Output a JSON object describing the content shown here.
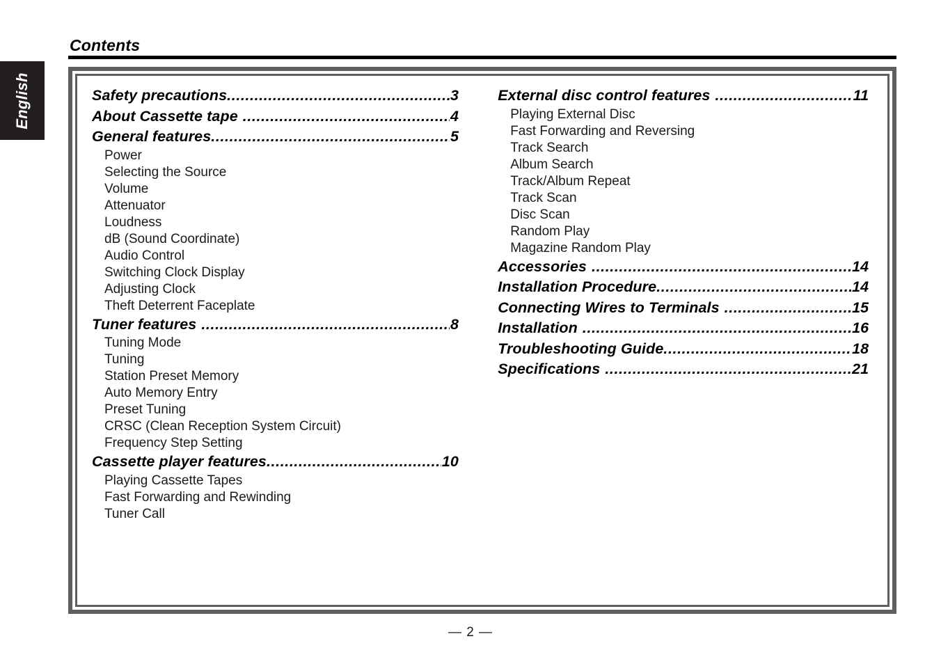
{
  "sidebar": {
    "language_tab": "English"
  },
  "header": {
    "title": "Contents"
  },
  "footer": {
    "page_marker": "— 2 —"
  },
  "leader": {
    "dots": "................................................................................................................"
  },
  "toc": {
    "left_column": [
      {
        "label": "Safety precautions",
        "page": "3",
        "gap": false,
        "children": []
      },
      {
        "label": "About Cassette tape",
        "page": "4",
        "gap": true,
        "children": []
      },
      {
        "label": "General features",
        "page": "5",
        "gap": false,
        "children": [
          "Power",
          "Selecting the Source",
          "Volume",
          "Attenuator",
          "Loudness",
          "dB (Sound Coordinate)",
          "Audio Control",
          "Switching Clock Display",
          "Adjusting Clock",
          "Theft Deterrent Faceplate"
        ]
      },
      {
        "label": "Tuner features",
        "page": "8",
        "gap": true,
        "children": [
          "Tuning Mode",
          "Tuning",
          "Station Preset Memory",
          "Auto Memory Entry",
          "Preset Tuning",
          "CRSC (Clean Reception System Circuit)",
          "Frequency Step Setting"
        ]
      },
      {
        "label": "Cassette player features",
        "page": "10",
        "gap": false,
        "children": [
          "Playing Cassette Tapes",
          "Fast Forwarding and Rewinding",
          "Tuner Call"
        ]
      }
    ],
    "right_column": [
      {
        "label": "External disc control features",
        "page": "11",
        "gap": true,
        "children": [
          "Playing External Disc",
          "Fast Forwarding and Reversing",
          "Track Search",
          "Album Search",
          "Track/Album Repeat",
          "Track Scan",
          "Disc Scan",
          "Random Play",
          "Magazine Random Play"
        ]
      },
      {
        "label": "Accessories",
        "page": "14",
        "gap": true,
        "children": []
      },
      {
        "label": "Installation Procedure",
        "page": "14",
        "gap": false,
        "children": []
      },
      {
        "label": "Connecting Wires to Terminals",
        "page": "15",
        "gap": true,
        "children": []
      },
      {
        "label": "Installation",
        "page": "16",
        "gap": true,
        "children": []
      },
      {
        "label": "Troubleshooting Guide",
        "page": "18",
        "gap": false,
        "children": []
      },
      {
        "label": "Specifications",
        "page": "21",
        "gap": true,
        "children": []
      }
    ]
  },
  "colors": {
    "frame": "#5f5f5f",
    "tab_background": "#231f20",
    "rule": "#000000"
  }
}
